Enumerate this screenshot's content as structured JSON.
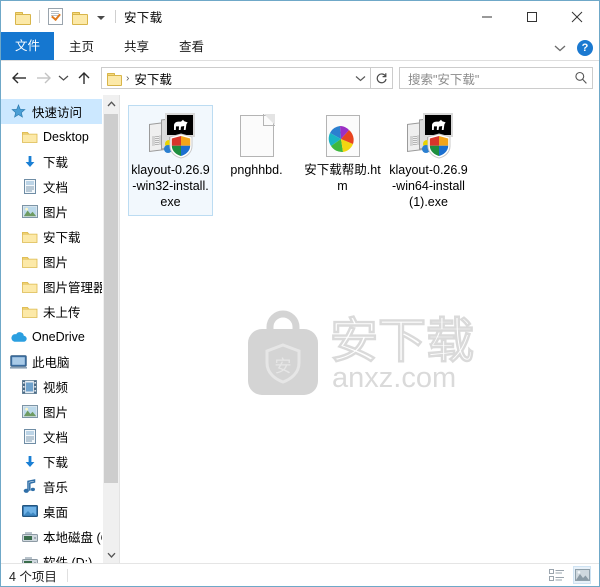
{
  "window": {
    "title": "安下载",
    "quick_access_toolbar": [
      {
        "name": "folder-icon",
        "label": ""
      },
      {
        "name": "properties-icon",
        "label": ""
      },
      {
        "name": "new-folder-icon",
        "label": ""
      },
      {
        "name": "customize-caret-icon",
        "label": ""
      }
    ],
    "controls": {
      "minimize": "—",
      "maximize": "□",
      "close": "✕"
    }
  },
  "ribbon": {
    "tabs": [
      {
        "label": "文件",
        "active": true
      },
      {
        "label": "主页",
        "active": false
      },
      {
        "label": "共享",
        "active": false
      },
      {
        "label": "查看",
        "active": false
      }
    ],
    "help_label": "?"
  },
  "navbar": {
    "back": "←",
    "forward": "→",
    "recent": "⌄",
    "up": "↑",
    "address_crumb": "安下载",
    "address_separator": "›",
    "refresh": "↻",
    "search_placeholder": "搜索\"安下载\""
  },
  "sidebar": {
    "items": [
      {
        "label": "快速访问",
        "icon": "star-icon",
        "indent": 0,
        "selected": true,
        "pinned": false
      },
      {
        "label": "Desktop",
        "icon": "folder-icon",
        "indent": 1,
        "selected": false,
        "pinned": true
      },
      {
        "label": "下载",
        "icon": "download-arrow-icon",
        "indent": 1,
        "selected": false,
        "pinned": true
      },
      {
        "label": "文档",
        "icon": "documents-icon",
        "indent": 1,
        "selected": false,
        "pinned": true
      },
      {
        "label": "图片",
        "icon": "pictures-icon",
        "indent": 1,
        "selected": false,
        "pinned": true
      },
      {
        "label": "安下载",
        "icon": "folder-icon",
        "indent": 1,
        "selected": false,
        "pinned": false
      },
      {
        "label": "图片",
        "icon": "folder-icon",
        "indent": 1,
        "selected": false,
        "pinned": false
      },
      {
        "label": "图片管理器",
        "icon": "folder-icon",
        "indent": 1,
        "selected": false,
        "pinned": false
      },
      {
        "label": "未上传",
        "icon": "folder-icon",
        "indent": 1,
        "selected": false,
        "pinned": false
      },
      {
        "label": "OneDrive",
        "icon": "onedrive-cloud-icon",
        "indent": 0,
        "selected": false,
        "pinned": false
      },
      {
        "label": "此电脑",
        "icon": "this-pc-monitor-icon",
        "indent": 0,
        "selected": false,
        "pinned": false
      },
      {
        "label": "视频",
        "icon": "videos-icon",
        "indent": 1,
        "selected": false,
        "pinned": false
      },
      {
        "label": "图片",
        "icon": "pictures-icon",
        "indent": 1,
        "selected": false,
        "pinned": false
      },
      {
        "label": "文档",
        "icon": "documents-icon",
        "indent": 1,
        "selected": false,
        "pinned": false
      },
      {
        "label": "下载",
        "icon": "download-arrow-icon",
        "indent": 1,
        "selected": false,
        "pinned": false
      },
      {
        "label": "音乐",
        "icon": "music-note-icon",
        "indent": 1,
        "selected": false,
        "pinned": false
      },
      {
        "label": "桌面",
        "icon": "desktop-icon",
        "indent": 1,
        "selected": false,
        "pinned": false
      },
      {
        "label": "本地磁盘 (C",
        "icon": "drive-icon",
        "indent": 1,
        "selected": false,
        "pinned": false
      },
      {
        "label": "软件 (D:)",
        "icon": "drive-icon",
        "indent": 1,
        "selected": false,
        "pinned": false
      }
    ],
    "scroll_up": "⌃",
    "scroll_down": "⌄"
  },
  "files": [
    {
      "name": "klayout-0.26.9-win32-install.exe",
      "icon": "exe-installer-icon",
      "selected": true
    },
    {
      "name": "pnghhbd.",
      "icon": "blank-document-icon",
      "selected": false
    },
    {
      "name": "安下载帮助.htm",
      "icon": "html-pinwheel-icon",
      "selected": false
    },
    {
      "name": "klayout-0.26.9-win64-install (1).exe",
      "icon": "exe-installer-icon",
      "selected": false
    }
  ],
  "watermark": {
    "brand": "安下载",
    "domain": "anxz.com",
    "shield_char": "安"
  },
  "statusbar": {
    "item_count": "4 个项目",
    "views": [
      {
        "name": "details-view-icon",
        "active": false
      },
      {
        "name": "large-icons-view-icon",
        "active": true
      }
    ]
  },
  "colors": {
    "accent": "#1577d0",
    "selection": "#cce8ff",
    "folder": "#fce9a8",
    "help": "#1b79d0"
  }
}
